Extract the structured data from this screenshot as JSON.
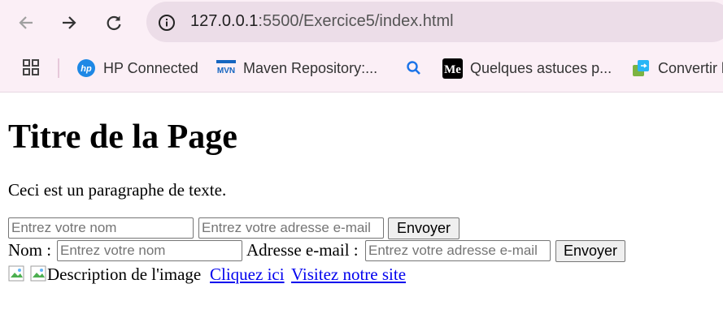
{
  "browser": {
    "url_host": "127.0.0.1",
    "url_rest": ":5500/Exercice5/index.html",
    "bookmarks": [
      {
        "label": "HP Connected",
        "icon": "hp-logo-icon"
      },
      {
        "label": "Maven Repository:...",
        "icon": "mvn-logo-icon"
      },
      {
        "label": "",
        "icon": "search-icon"
      },
      {
        "label": "Quelques astuces p...",
        "icon": "medium-logo-icon"
      },
      {
        "label": "Convertir l",
        "icon": "convert-icon"
      }
    ]
  },
  "page": {
    "title": "Titre de la Page",
    "paragraph": "Ceci est un paragraphe de texte.",
    "form1": {
      "name_placeholder": "Entrez votre nom",
      "email_placeholder": "Entrez votre adresse e-mail",
      "submit_label": "Envoyer"
    },
    "form2": {
      "name_label": "Nom :",
      "name_placeholder": "Entrez votre nom",
      "email_label": "Adresse e-mail :",
      "email_placeholder": "Entrez votre adresse e-mail",
      "submit_label": "Envoyer"
    },
    "image_alt": "Description de l'image",
    "link1": "Cliquez ici",
    "link2": "Visitez notre site"
  }
}
